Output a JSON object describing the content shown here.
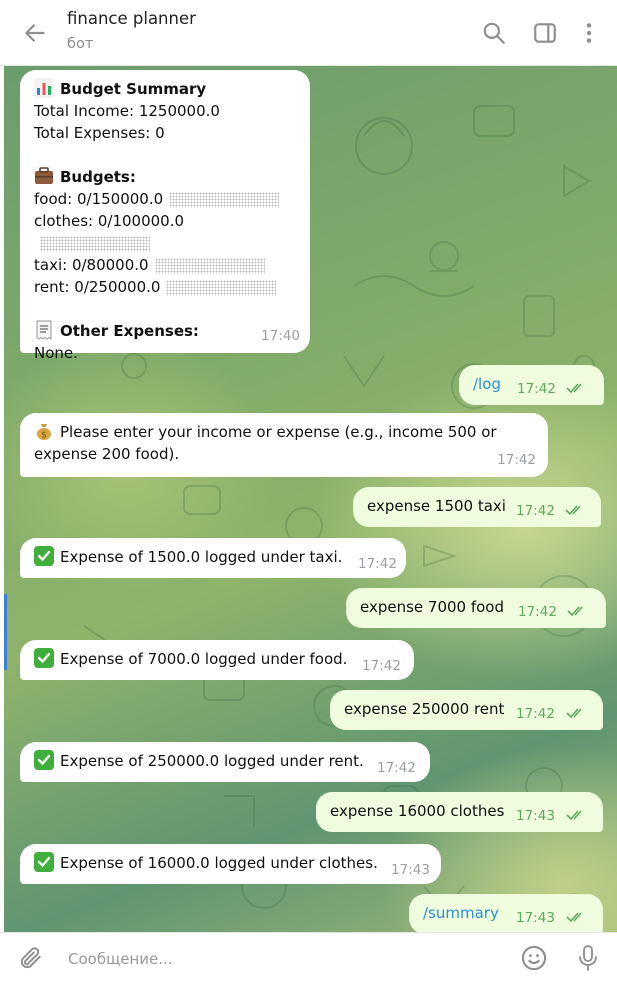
{
  "header": {
    "title": "finance planner",
    "subtitle": "бот",
    "icons": [
      "back-arrow-icon",
      "search-icon",
      "sidebar-toggle-icon",
      "more-vertical-icon"
    ]
  },
  "messages": {
    "m1": {
      "title": "Budget Summary",
      "income": "Total Income: 1250000.0",
      "expenses": "Total Expenses: 0",
      "budgets_title": "Budgets:",
      "budgets": [
        "food: 0/150000.0",
        "clothes: 0/100000.0",
        "taxi: 0/80000.0",
        "rent: 0/250000.0"
      ],
      "other_title": "Other Expenses:",
      "other_value": "None.",
      "time": "17:40"
    },
    "m2": {
      "text": "/log",
      "time": "17:42"
    },
    "m3": {
      "line1": "Please enter your income or expense (e.g., income 500 or",
      "line2": "expense 200 food).",
      "time": "17:42"
    },
    "m4": {
      "text": "expense 1500 taxi",
      "time": "17:42"
    },
    "m5": {
      "text": "Expense of 1500.0 logged under taxi.",
      "time": "17:42"
    },
    "m6": {
      "text": "expense 7000 food",
      "time": "17:42"
    },
    "m7": {
      "text": "Expense of 7000.0 logged under food.",
      "time": "17:42"
    },
    "m8": {
      "text": "expense 250000 rent",
      "time": "17:42"
    },
    "m9": {
      "text": "Expense of 250000.0 logged under rent.",
      "time": "17:42"
    },
    "m10": {
      "text": "expense 16000 clothes",
      "time": "17:43"
    },
    "m11": {
      "text": "Expense of 16000.0 logged under clothes.",
      "time": "17:43"
    },
    "m12": {
      "text": "/summary",
      "time": "17:43"
    }
  },
  "composer": {
    "placeholder": "Сообщение..."
  },
  "colors": {
    "incoming_bubble": "#ffffff",
    "outgoing_bubble": "#effdde",
    "outgoing_time": "#5fa95f",
    "link": "#2b90d9"
  }
}
